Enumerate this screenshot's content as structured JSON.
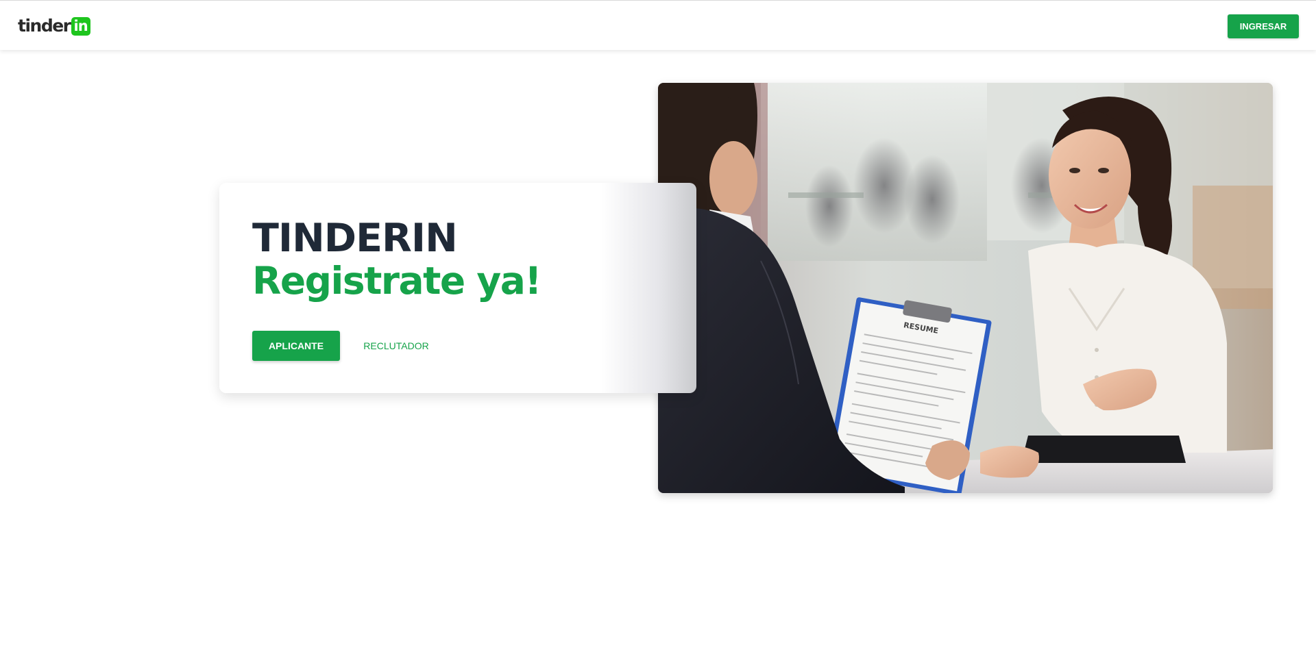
{
  "header": {
    "logo": {
      "word": "tinder",
      "badge": "in"
    },
    "login_label": "INGRESAR"
  },
  "hero": {
    "title": "TINDERIN",
    "subtitle": "Registrate ya!",
    "primary_button": "APLICANTE",
    "secondary_button": "RECLUTADOR",
    "photo": {
      "clipboard_heading": "RESUME"
    }
  },
  "colors": {
    "accent": "#16a34a",
    "logo_badge": "#1ec51e",
    "title": "#1f2937"
  },
  "icons": [
    "logo-mark",
    "interview-photo"
  ]
}
